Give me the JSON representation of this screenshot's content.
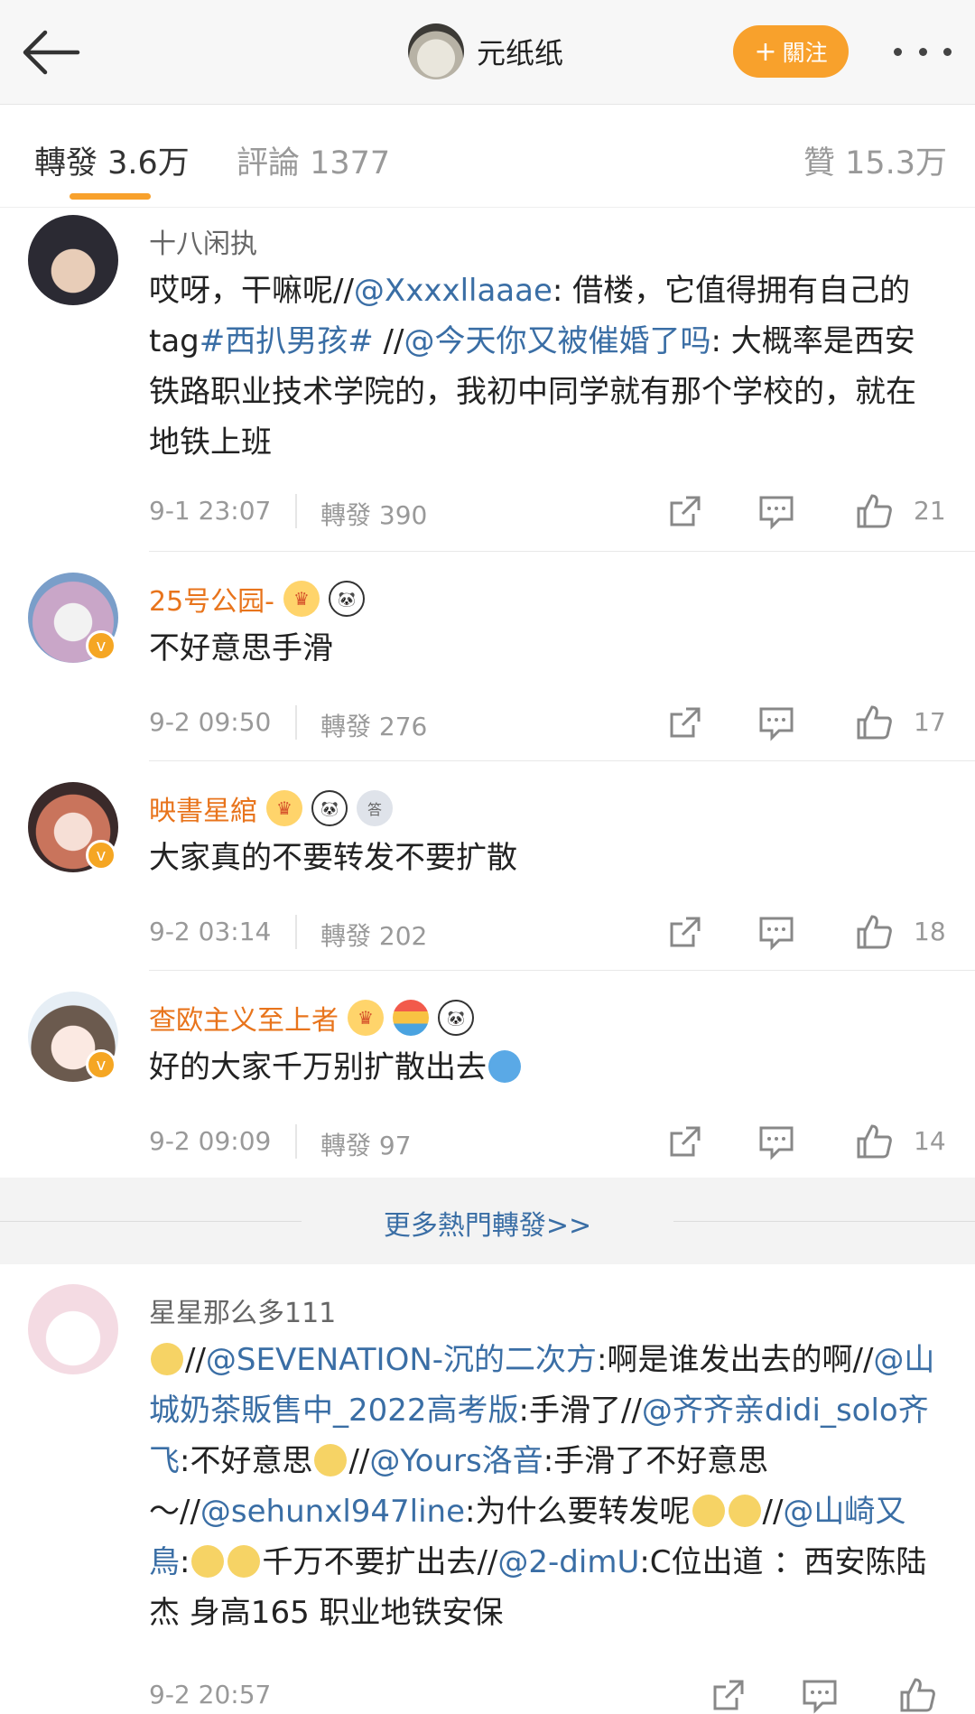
{
  "header": {
    "name": "元纸纸",
    "follow_label": "關注",
    "follow_plus": "+"
  },
  "tabs": [
    {
      "label": "轉發 3.6万"
    },
    {
      "label": "評論 1377"
    },
    {
      "label": "贊 15.3万"
    }
  ],
  "comments": [
    {
      "user": "十八闲执",
      "text_parts": [
        "哎呀，干嘛呢//",
        "@Xxxxllaaae",
        ": 借楼，它值得拥有自己的tag",
        "#西扒男孩#",
        " //",
        "@今天你又被催婚了吗",
        ": 大概率是西安铁路职业技术学院的，我初中同学就有那个学校的，就在地铁上班"
      ],
      "time": "9-1 23:07",
      "forward": "轉發 390",
      "likes": "21"
    },
    {
      "user": "25号公园-",
      "badge_crown": "♛",
      "badge_panda": "🐼",
      "text": "不好意思手滑",
      "time": "9-2 09:50",
      "forward": "轉發 276",
      "likes": "17"
    },
    {
      "user": "映書星綰",
      "badge_crown": "♛",
      "badge_panda": "🐼",
      "badge_medal": "答",
      "text": "大家真的不要转发不要扩散",
      "time": "9-2 03:14",
      "forward": "轉發 202",
      "likes": "18"
    },
    {
      "user": "查欧主义至上者",
      "badge_crown": "♛",
      "badge_balloon": "",
      "badge_panda": "🐼",
      "text": "好的大家千万别扩散出去",
      "time": "9-2 09:09",
      "forward": "轉發 97",
      "likes": "14"
    }
  ],
  "more_hot_label": "更多熱門轉發>>",
  "last_comment": {
    "user": "星星那么多111",
    "parts": [
      "//",
      "@SEVENATION-沉的二次方",
      ":啊是谁发出去的啊//",
      "@山城奶茶販售中_2022高考版",
      ":手滑了//",
      "@齐齐亲didi_solo齐飞",
      ":不好意思",
      "//",
      "@Yours洛音",
      ":手滑了不好意思～//",
      "@sehunxl947line",
      ":为什么要转发呢",
      "//",
      "@山崎又鳥",
      ":",
      "千万不要扩出去//",
      "@2-dimU",
      ":C位出道 ：西安陈陆杰 身高165 职业地铁安保"
    ],
    "time": "9-2 20:57"
  },
  "icons": [
    "back-arrow-icon",
    "share-icon",
    "comment-icon",
    "like-icon",
    "verified-icon"
  ],
  "colors": {
    "accent": "#f8a12c",
    "link": "#3a6ea5",
    "vip_name": "#e8741c"
  }
}
